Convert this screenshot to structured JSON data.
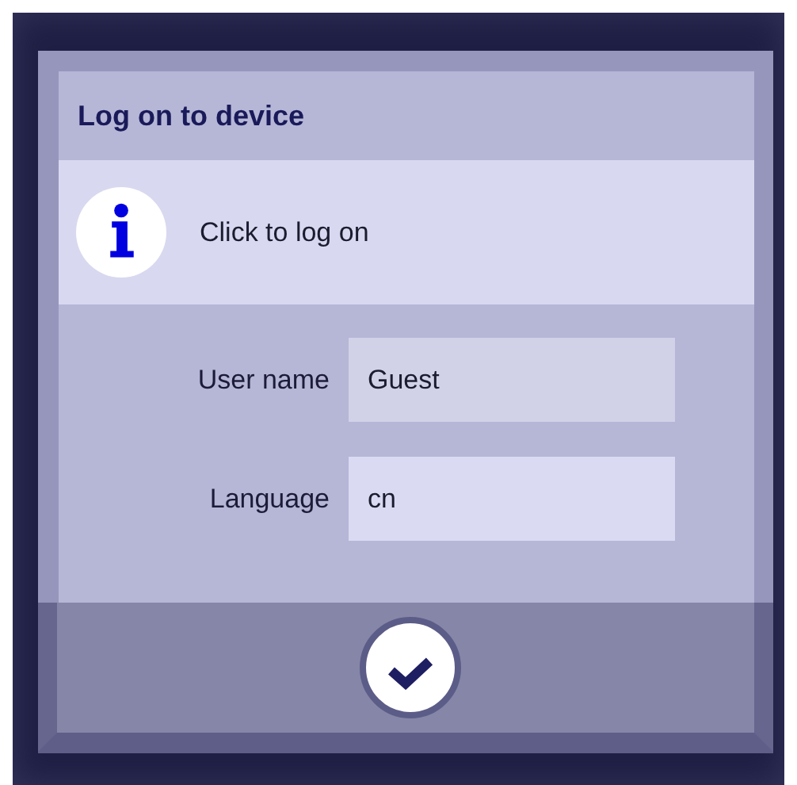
{
  "dialog": {
    "title": "Log on to device",
    "message": "Click to log on"
  },
  "fields": [
    {
      "label": "User name",
      "value": "Guest"
    },
    {
      "label": "Language",
      "value": "cn"
    }
  ]
}
